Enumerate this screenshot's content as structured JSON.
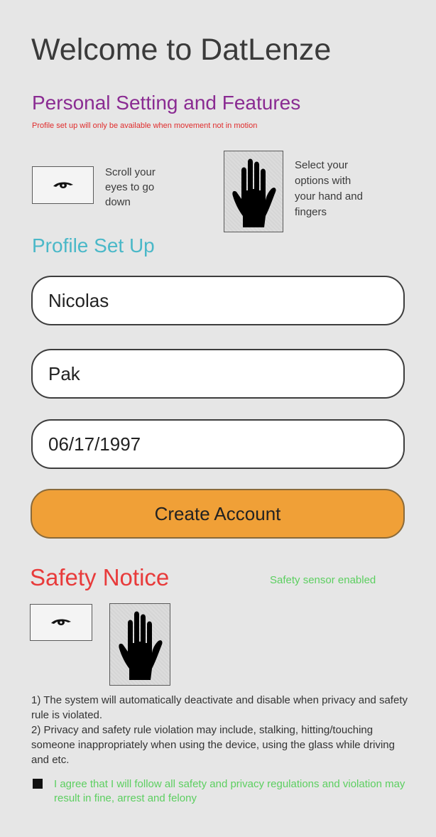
{
  "header": {
    "title": "Welcome to DatLenze",
    "subtitle": "Personal Setting and Features",
    "warning": "Profile set up will only be available when movement not in motion"
  },
  "features": {
    "eye_caption": "Scroll your\neyes to go\ndown",
    "hand_caption": "Select your\noptions with\nyour hand and\nfingers"
  },
  "profile": {
    "heading": "Profile Set Up",
    "first_name": "Nicolas",
    "last_name": "Pak",
    "birthdate": "06/17/1997",
    "create_label": "Create Account"
  },
  "safety": {
    "heading": "Safety Notice",
    "sensor_status": "Safety sensor enabled",
    "rule_1": "1) The system will automatically deactivate and disable when privacy and safety rule is violated.",
    "rule_2": "2) Privacy and safety rule violation may include, stalking, hitting/touching someone inappropriately when using the device, using the glass while driving and etc.",
    "agree_text": "I agree that I will follow all safety and privacy regulations and violation may result in fine, arrest and felony",
    "agree_checked": true
  },
  "colors": {
    "accent_purple": "#8a2b92",
    "warning_red": "#e02c2c",
    "profile_teal": "#4ab8c8",
    "button_orange": "#f0a037",
    "safety_red": "#e83b3b",
    "success_green": "#5ccf60"
  },
  "icons": {
    "eye": "eye-icon",
    "hand": "hand-icon"
  }
}
